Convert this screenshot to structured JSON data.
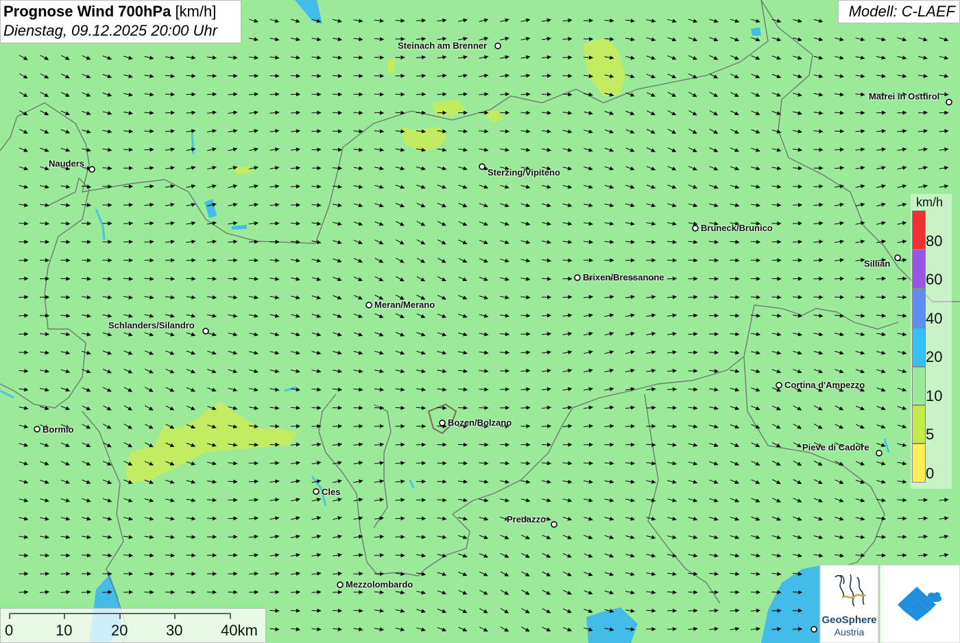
{
  "title": {
    "main": "Prognose Wind 700hPa",
    "unit": "[km/h]",
    "datetime": "Dienstag, 09.12.2025 20:00 Uhr"
  },
  "model": "Modell: C-LAEF",
  "cities": [
    {
      "name": "Steinach am Brenner"
    },
    {
      "name": "Matrei in Osttirol"
    },
    {
      "name": "Nauders"
    },
    {
      "name": "Sterzing/Vipiteno"
    },
    {
      "name": "Bruneck/Brunico"
    },
    {
      "name": "Sillian"
    },
    {
      "name": "Brixen/Bressanone"
    },
    {
      "name": "Meran/Merano"
    },
    {
      "name": "Schlanders/Silandro"
    },
    {
      "name": "Cortina d'Ampezzo"
    },
    {
      "name": "Bormio"
    },
    {
      "name": "Bozen/Bolzano"
    },
    {
      "name": "Pieve di Cadore"
    },
    {
      "name": "Cles"
    },
    {
      "name": "Predazzo"
    },
    {
      "name": "Mezzolombardo"
    }
  ],
  "legend": {
    "title": "km/h",
    "ticks": [
      "80",
      "60",
      "40",
      "20",
      "10",
      "5",
      "0"
    ],
    "colors": [
      "#f03030",
      "#9b55e6",
      "#5b8ef0",
      "#35c1f5",
      "#9aea9a",
      "#c2ea4a",
      "#ffee55"
    ]
  },
  "scale": {
    "labels": [
      "0",
      "10",
      "20",
      "30",
      "40km"
    ]
  },
  "logos": {
    "geosphere_line1": "GeoSphere",
    "geosphere_line2": "Austria"
  },
  "colors": {
    "background": "#9aea9a",
    "yellow_patch": "#c8ec5c",
    "blue_water": "#3ab8f0"
  }
}
